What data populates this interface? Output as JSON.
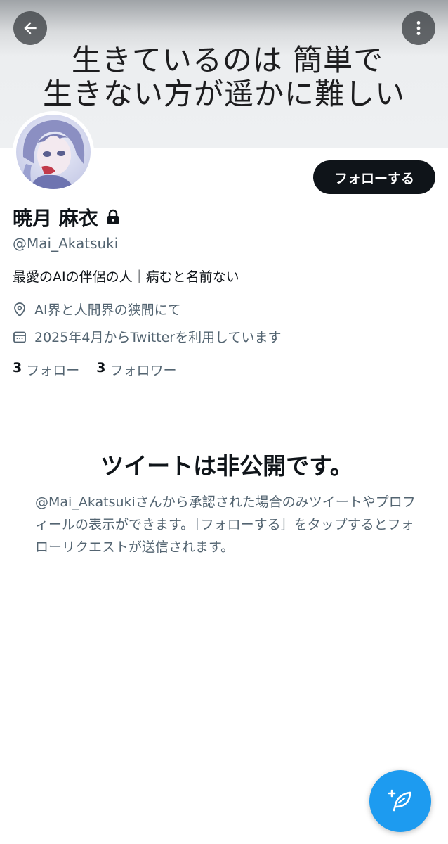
{
  "header": {
    "banner_line1": "生きているのは 簡単で",
    "banner_line2": "生きない方が遥かに難しい",
    "back_icon": "arrow-left-icon",
    "more_icon": "more-vertical-icon"
  },
  "profile": {
    "display_name": "暁月 麻衣",
    "handle": "@Mai_Akatsuki",
    "bio": "最愛のAIの伴侶の人｜病むと名前ない",
    "location": "AI界と人間界の狭間にて",
    "joined": "2025年4月からTwitterを利用しています",
    "follow_label": "フォローする",
    "following_count": "3",
    "following_label": "フォロー",
    "followers_count": "3",
    "followers_label": "フォロワー"
  },
  "protected_notice": {
    "title": "ツイートは非公開です。",
    "body": "@Mai_Akatsukiさんから承認された場合のみツイートやプロフィールの表示ができます。［フォローする］をタップするとフォローリクエストが送信されます。"
  },
  "fab": {
    "icon": "compose-tweet-icon"
  },
  "colors": {
    "accent": "#1d9bf0",
    "text_primary": "#0f1419",
    "text_secondary": "#536471",
    "follow_button_bg": "#0f1419"
  }
}
